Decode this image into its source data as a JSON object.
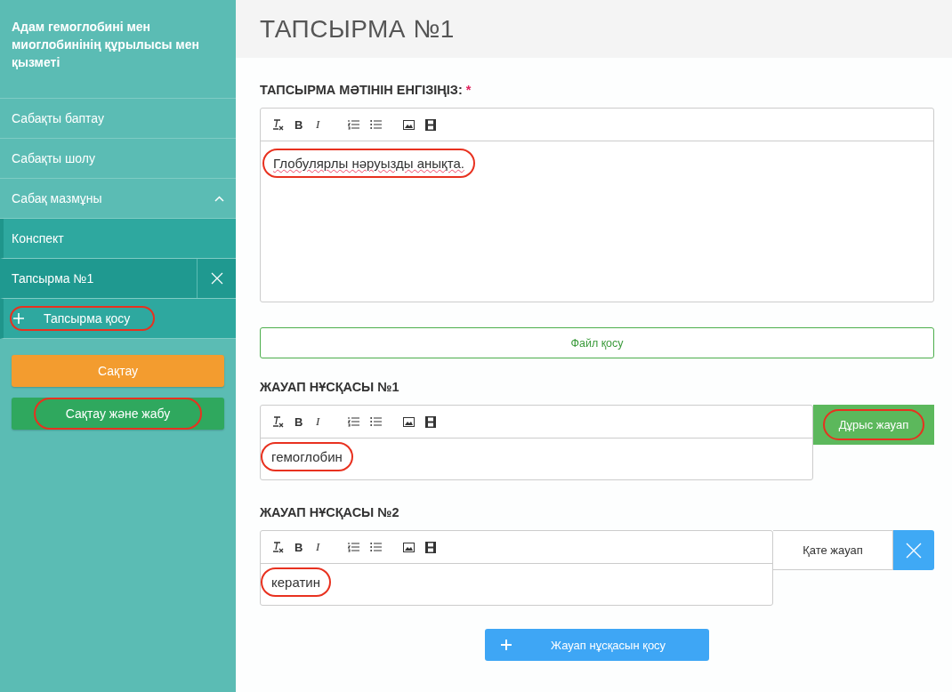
{
  "sidebar": {
    "title": "Адам гемоглобині мен миоглобинінің құрылысы мен қызметі",
    "items": [
      {
        "label": "Сабақты баптау",
        "expanded": false
      },
      {
        "label": "Сабақты шолу",
        "expanded": false
      },
      {
        "label": "Сабақ мазмұны",
        "expanded": true,
        "children": [
          {
            "label": "Конспект",
            "selected": false,
            "kind": "item",
            "highlighted": false
          },
          {
            "label": "Тапсырма №1",
            "selected": true,
            "kind": "item",
            "highlighted": false
          },
          {
            "label": "Тапсырма қосу",
            "selected": false,
            "kind": "add",
            "highlighted": true
          }
        ]
      }
    ],
    "buttons": [
      {
        "label": "Сақтау",
        "kind": "save",
        "highlighted": false
      },
      {
        "label": "Сақтау және жабу",
        "kind": "save-close",
        "highlighted": true
      }
    ]
  },
  "page_title": "ТАПСЫРМА №1",
  "task": {
    "label": "ТАПСЫРМА МӘТІНІН ЕНГІЗІҢІЗ:",
    "required_mark": "*",
    "toolbar": [
      {
        "kind": "clear-format"
      },
      {
        "kind": "bold",
        "glyph": "B"
      },
      {
        "kind": "italic",
        "glyph": "I"
      },
      {
        "kind": "ordered-list"
      },
      {
        "kind": "bullet-list"
      },
      {
        "kind": "image"
      },
      {
        "kind": "video"
      }
    ],
    "text": "Глобулярлы нәруызды анықта.",
    "highlighted": true
  },
  "file_button": "Файл қосу",
  "answers": [
    {
      "label": "ЖАУАП НҰСҚАСЫ №1",
      "correct": true,
      "status": "Дұрыс жауап",
      "status_highlighted": true,
      "toolbar": [
        {
          "kind": "clear-format"
        },
        {
          "kind": "bold",
          "glyph": "B"
        },
        {
          "kind": "italic",
          "glyph": "I"
        },
        {
          "kind": "ordered-list"
        },
        {
          "kind": "bullet-list"
        },
        {
          "kind": "image"
        },
        {
          "kind": "video"
        }
      ],
      "text": "гемоглобин",
      "highlighted": true
    },
    {
      "label": "ЖАУАП НҰСҚАСЫ №2",
      "correct": false,
      "status": "Қате жауап",
      "status_highlighted": false,
      "toolbar": [
        {
          "kind": "clear-format"
        },
        {
          "kind": "bold",
          "glyph": "B"
        },
        {
          "kind": "italic",
          "glyph": "I"
        },
        {
          "kind": "ordered-list"
        },
        {
          "kind": "bullet-list"
        },
        {
          "kind": "image"
        },
        {
          "kind": "video"
        }
      ],
      "text": "кератин",
      "highlighted": true
    }
  ],
  "add_answer_button": "Жауап нұсқасын қосу"
}
